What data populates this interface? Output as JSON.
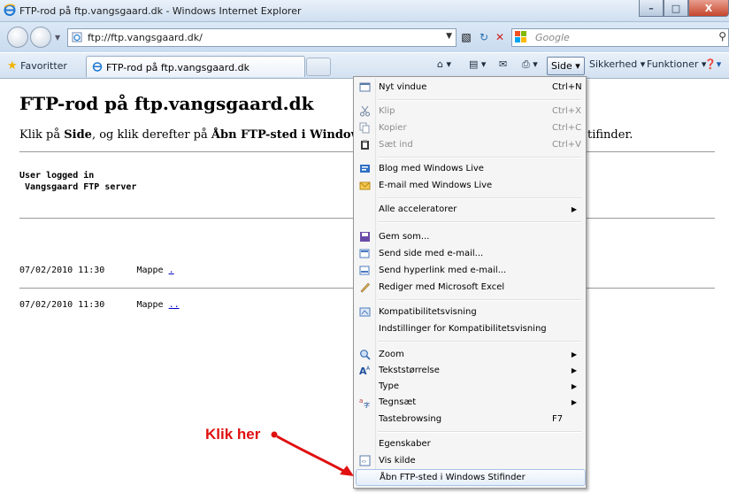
{
  "window": {
    "title": "FTP-rod på ftp.vangsgaard.dk - Windows Internet Explorer",
    "buttons": {
      "minimize": "–",
      "maximize": "□",
      "close": "X"
    }
  },
  "addressbar": {
    "url": "ftp://ftp.vangsgaard.dk/",
    "search_placeholder": "Google"
  },
  "favbar": {
    "favorites_label": "Favoritter",
    "tab_label": "FTP-rod på ftp.vangsgaard.dk",
    "side_label": "Side ▾",
    "safety_label": "Sikkerhed ▾",
    "tools_label": "Funktioner ▾"
  },
  "page": {
    "heading": "FTP-rod på ftp.vangsgaard.dk",
    "instr_start": "Klik på ",
    "instr_side": "Side",
    "instr_mid": ", og klik derefter på ",
    "instr_open": "Åbn FTP-sted i Windows Stifi",
    "instr_tail": "tifinder.",
    "banner_line1": "User logged in",
    "banner_line2": " Vangsgaard FTP server",
    "listing": [
      {
        "date": "07/02/2010 11:30",
        "type": "Mappe",
        "name": "."
      },
      {
        "date": "07/02/2010 11:30",
        "type": "Mappe",
        "name": ".."
      }
    ]
  },
  "menu": {
    "items": [
      {
        "label": "Nyt vindue",
        "shortcut": "Ctrl+N"
      },
      {
        "label": "Klip",
        "shortcut": "Ctrl+X"
      },
      {
        "label": "Kopier",
        "shortcut": "Ctrl+C"
      },
      {
        "label": "Sæt ind",
        "shortcut": "Ctrl+V"
      },
      {
        "label": "Blog med Windows Live"
      },
      {
        "label": "E-mail med Windows Live"
      },
      {
        "label": "Alle acceleratorer"
      },
      {
        "label": "Gem som..."
      },
      {
        "label": "Send side med e-mail..."
      },
      {
        "label": "Send hyperlink med e-mail..."
      },
      {
        "label": "Rediger med Microsoft Excel"
      },
      {
        "label": "Kompatibilitetsvisning"
      },
      {
        "label": "Indstillinger for Kompatibilitetsvisning"
      },
      {
        "label": "Zoom"
      },
      {
        "label": "Tekststørrelse"
      },
      {
        "label": "Type"
      },
      {
        "label": "Tegnsæt"
      },
      {
        "label": "Tastebrowsing",
        "shortcut": "F7"
      },
      {
        "label": "Egenskaber"
      },
      {
        "label": "Vis kilde"
      },
      {
        "label": "Åbn FTP-sted i Windows Stifinder"
      }
    ],
    "submenu_arrow": "▶"
  },
  "annotation": {
    "text": "Klik her",
    "color": "#e01010"
  }
}
